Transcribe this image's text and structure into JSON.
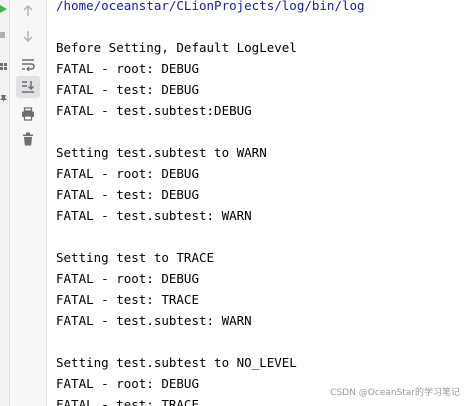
{
  "toolbar": {
    "buttons": [
      {
        "name": "scroll-up-icon",
        "active": false
      },
      {
        "name": "scroll-down-icon",
        "active": false
      },
      {
        "name": "soft-wrap-icon",
        "active": false
      },
      {
        "name": "scroll-to-end-icon",
        "active": true
      },
      {
        "name": "print-icon",
        "active": false
      },
      {
        "name": "trash-icon",
        "active": false
      }
    ]
  },
  "console": {
    "lines": [
      "/home/oceanstar/CLionProjects/log/bin/log",
      "",
      "Before Setting, Default LogLevel",
      "FATAL - root: DEBUG",
      "FATAL - test: DEBUG",
      "FATAL - test.subtest:DEBUG",
      "",
      "Setting test.subtest to WARN",
      "FATAL - root: DEBUG",
      "FATAL - test: DEBUG",
      "FATAL - test.subtest: WARN",
      "",
      "Setting test to TRACE",
      "FATAL - root: DEBUG",
      "FATAL - test: TRACE",
      "FATAL - test.subtest: WARN",
      "",
      "Setting test.subtest to NO_LEVEL",
      "FATAL - root: DEBUG",
      "FATAL - test: TRACE"
    ]
  },
  "watermark": "CSDN @OceanStar的学习笔记",
  "colors": {
    "path": "#1a1aa6",
    "text": "#000000",
    "run_green": "#4caf50"
  }
}
